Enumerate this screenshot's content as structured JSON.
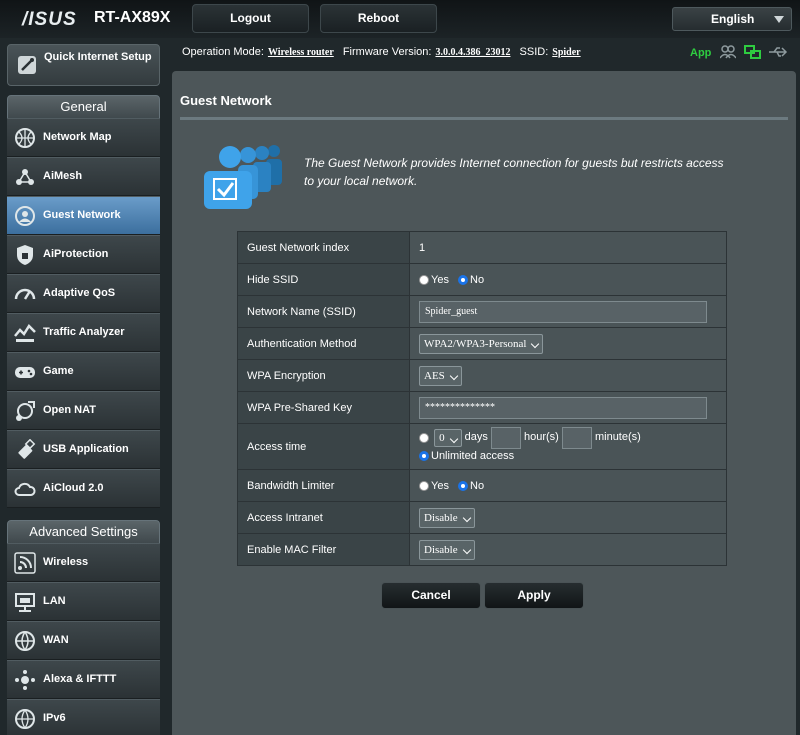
{
  "header": {
    "logo": "/ISUS",
    "model": "RT-AX89X",
    "logout": "Logout",
    "reboot": "Reboot",
    "language": "English"
  },
  "status": {
    "mode_label": "Operation Mode:",
    "mode": "Wireless router",
    "fw_label": "Firmware Version:",
    "fw": "3.0.0.4.386_23012",
    "ssid_label": "SSID:",
    "ssid": "Spider",
    "app": "App"
  },
  "sidebar": {
    "qis": "Quick Internet Setup",
    "general": "General",
    "general_items": [
      {
        "label": "Network Map",
        "icon": "network-map-icon"
      },
      {
        "label": "AiMesh",
        "icon": "aimesh-icon"
      },
      {
        "label": "Guest Network",
        "icon": "guest-network-icon"
      },
      {
        "label": "AiProtection",
        "icon": "aiprotection-icon"
      },
      {
        "label": "Adaptive QoS",
        "icon": "qos-icon"
      },
      {
        "label": "Traffic Analyzer",
        "icon": "traffic-analyzer-icon"
      },
      {
        "label": "Game",
        "icon": "game-icon"
      },
      {
        "label": "Open NAT",
        "icon": "open-nat-icon"
      },
      {
        "label": "USB Application",
        "icon": "usb-icon"
      },
      {
        "label": "AiCloud 2.0",
        "icon": "aicloud-icon"
      }
    ],
    "advanced": "Advanced Settings",
    "advanced_items": [
      {
        "label": "Wireless",
        "icon": "wireless-icon"
      },
      {
        "label": "LAN",
        "icon": "lan-icon"
      },
      {
        "label": "WAN",
        "icon": "wan-icon"
      },
      {
        "label": "Alexa & IFTTT",
        "icon": "alexa-icon"
      },
      {
        "label": "IPv6",
        "icon": "ipv6-icon"
      }
    ]
  },
  "main": {
    "title": "Guest Network",
    "description": "The Guest Network provides Internet connection for guests but restricts access to your local network.",
    "rows": {
      "index": {
        "label": "Guest Network index",
        "value": "1"
      },
      "hide_ssid": {
        "label": "Hide SSID",
        "yes": "Yes",
        "no": "No",
        "selected": "No"
      },
      "ssid": {
        "label": "Network Name (SSID)",
        "value": "Spider_guest"
      },
      "auth": {
        "label": "Authentication Method",
        "value": "WPA2/WPA3-Personal"
      },
      "enc": {
        "label": "WPA Encryption",
        "value": "AES"
      },
      "psk": {
        "label": "WPA Pre-Shared Key",
        "value": "**************"
      },
      "access": {
        "label": "Access time",
        "days_value": "0",
        "days": "days",
        "hours": "hour(s)",
        "minutes": "minute(s)",
        "unlimited": "Unlimited access"
      },
      "bw": {
        "label": "Bandwidth Limiter",
        "yes": "Yes",
        "no": "No"
      },
      "intranet": {
        "label": "Access Intranet",
        "value": "Disable"
      },
      "mac": {
        "label": "Enable MAC Filter",
        "value": "Disable"
      }
    },
    "cancel": "Cancel",
    "apply": "Apply"
  }
}
